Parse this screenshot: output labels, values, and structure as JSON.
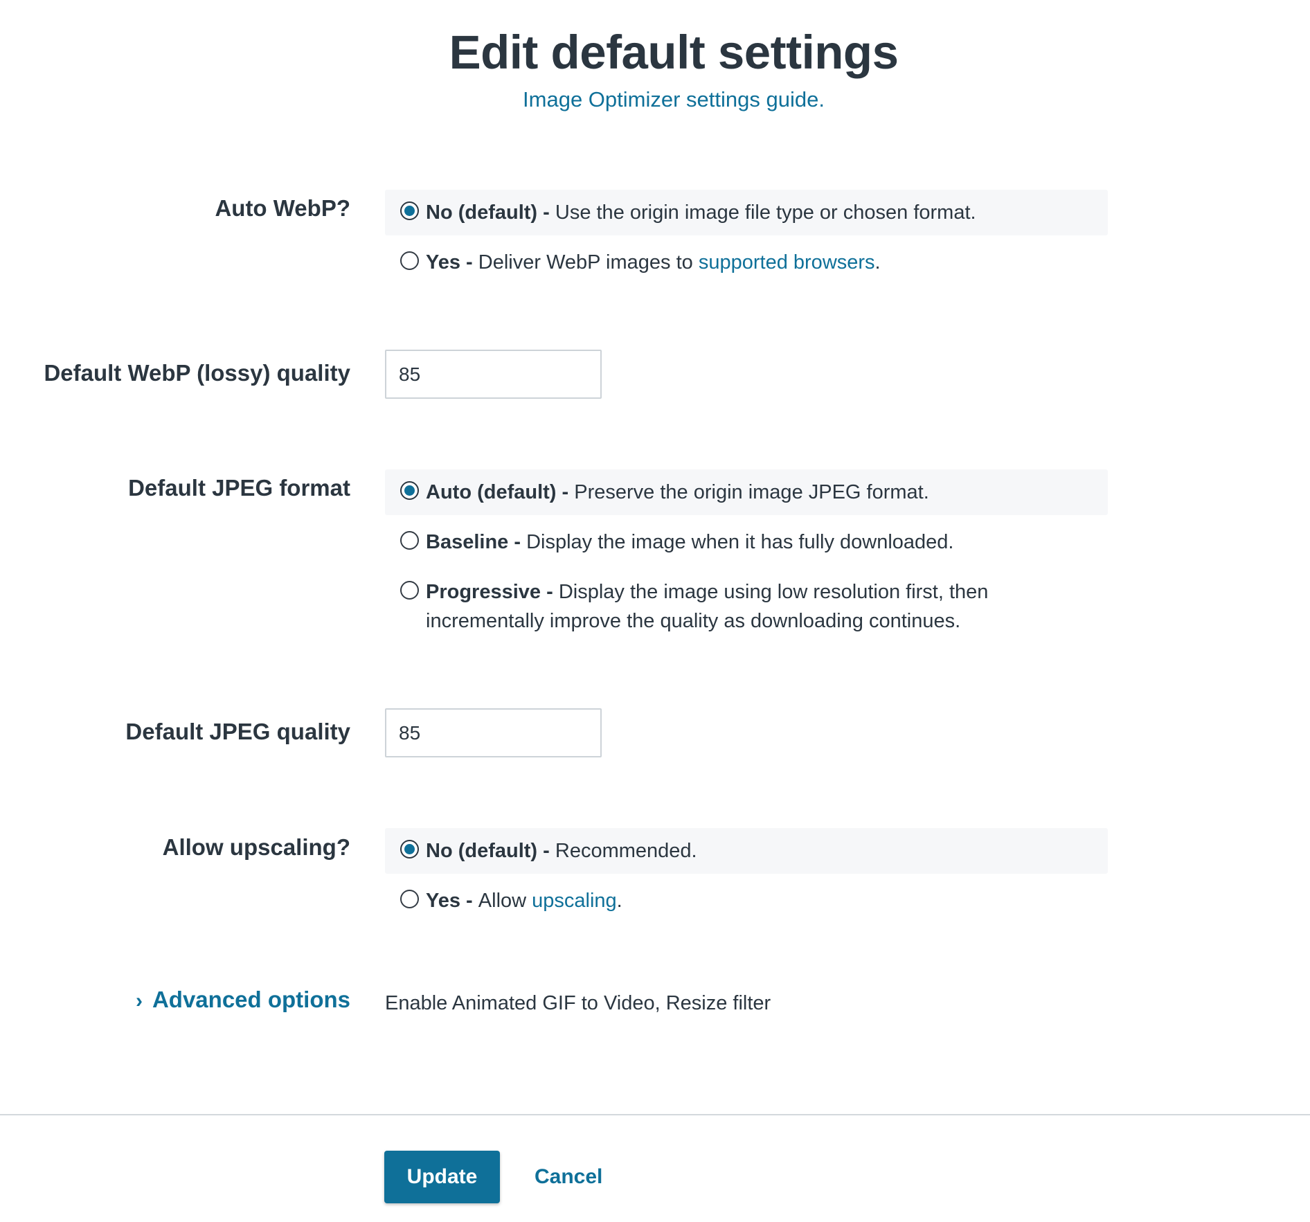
{
  "header": {
    "title": "Edit default settings",
    "guide_link": "Image Optimizer settings guide."
  },
  "auto_webp": {
    "label": "Auto WebP?",
    "options": [
      {
        "title": "No (default)",
        "sep": " - ",
        "desc": "Use the origin image file type or chosen format.",
        "selected": true
      },
      {
        "title": "Yes",
        "sep": " - ",
        "desc": "Deliver WebP images to ",
        "link": "supported browsers",
        "after": ".",
        "selected": false
      }
    ]
  },
  "webp_quality": {
    "label": "Default WebP (lossy) quality",
    "value": "85"
  },
  "jpeg_format": {
    "label": "Default JPEG format",
    "options": [
      {
        "title": "Auto (default)",
        "sep": " - ",
        "desc": "Preserve the origin image JPEG format.",
        "selected": true
      },
      {
        "title": "Baseline",
        "sep": " - ",
        "desc": "Display the image when it has fully downloaded.",
        "selected": false
      },
      {
        "title": "Progressive",
        "sep": " - ",
        "desc": "Display the image using low resolution first, then incrementally improve the quality as downloading continues.",
        "selected": false
      }
    ]
  },
  "jpeg_quality": {
    "label": "Default JPEG quality",
    "value": "85"
  },
  "upscaling": {
    "label": "Allow upscaling?",
    "options": [
      {
        "title": "No (default)",
        "sep": " - ",
        "desc": "Recommended.",
        "selected": true
      },
      {
        "title": "Yes",
        "sep": " - ",
        "desc": "Allow ",
        "link": "upscaling",
        "after": ".",
        "selected": false
      }
    ]
  },
  "advanced": {
    "label": "Advanced options",
    "description": "Enable Animated GIF to Video, Resize filter"
  },
  "actions": {
    "update": "Update",
    "cancel": "Cancel"
  },
  "colors": {
    "accent": "#0f7099",
    "text": "#2b3640",
    "selected_bg": "#f6f7f9"
  },
  "icons": {
    "advanced_toggle": "chevron-right-icon"
  }
}
